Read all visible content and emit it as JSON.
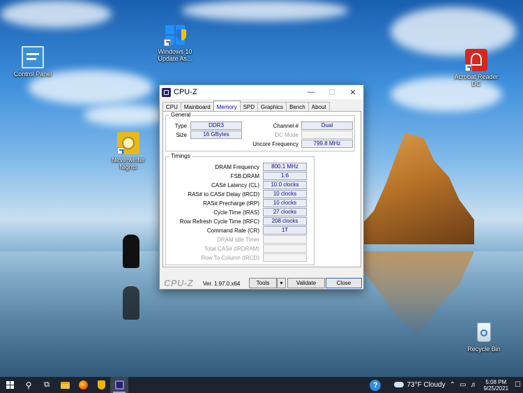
{
  "desktop": {
    "icons": [
      {
        "label": "Control Panel"
      },
      {
        "label": "Windows 10 Update As..."
      },
      {
        "label": "Acrobat Reader DC"
      },
      {
        "label": "Neverwinter Nights"
      },
      {
        "label": "Recycle Bin"
      }
    ]
  },
  "window": {
    "title": "CPU-Z",
    "tabs": [
      "CPU",
      "Mainboard",
      "Memory",
      "SPD",
      "Graphics",
      "Bench",
      "About"
    ],
    "active_tab": "Memory",
    "general": {
      "group_title": "General",
      "type_label": "Type",
      "type_value": "DDR3",
      "size_label": "Size",
      "size_value": "16 GBytes",
      "channel_label": "Channel #",
      "channel_value": "Dual",
      "dcmode_label": "DC Mode",
      "dcmode_value": "",
      "uncore_label": "Uncore Frequency",
      "uncore_value": "799.8 MHz"
    },
    "timings": {
      "group_title": "Timings",
      "rows": [
        {
          "label": "DRAM Frequency",
          "value": "800.1 MHz",
          "dim": false
        },
        {
          "label": "FSB:DRAM",
          "value": "1:6",
          "dim": false
        },
        {
          "label": "CAS# Latency (CL)",
          "value": "10.0 clocks",
          "dim": false
        },
        {
          "label": "RAS# to CAS# Delay (tRCD)",
          "value": "10 clocks",
          "dim": false
        },
        {
          "label": "RAS# Precharge (tRP)",
          "value": "10 clocks",
          "dim": false
        },
        {
          "label": "Cycle Time (tRAS)",
          "value": "27 clocks",
          "dim": false
        },
        {
          "label": "Row Refresh Cycle Time (tRFC)",
          "value": "208 clocks",
          "dim": false
        },
        {
          "label": "Command Rate (CR)",
          "value": "1T",
          "dim": false
        },
        {
          "label": "DRAM Idle Timer",
          "value": "",
          "dim": true
        },
        {
          "label": "Total CAS# (tRDRAM)",
          "value": "",
          "dim": true
        },
        {
          "label": "Row To Column (tRCD)",
          "value": "",
          "dim": true
        }
      ]
    },
    "footer": {
      "brand": "CPU-Z",
      "version": "Ver. 1.97.0.x64",
      "tools_label": "Tools",
      "validate_label": "Validate",
      "close_label": "Close"
    }
  },
  "taskbar": {
    "weather": "73°F  Cloudy",
    "time": "5:08 PM",
    "date": "9/25/2021"
  },
  "colors": {
    "taskbar": "#1d2430",
    "value_text": "#0a0a8a",
    "accent": "#2b6ad6"
  }
}
